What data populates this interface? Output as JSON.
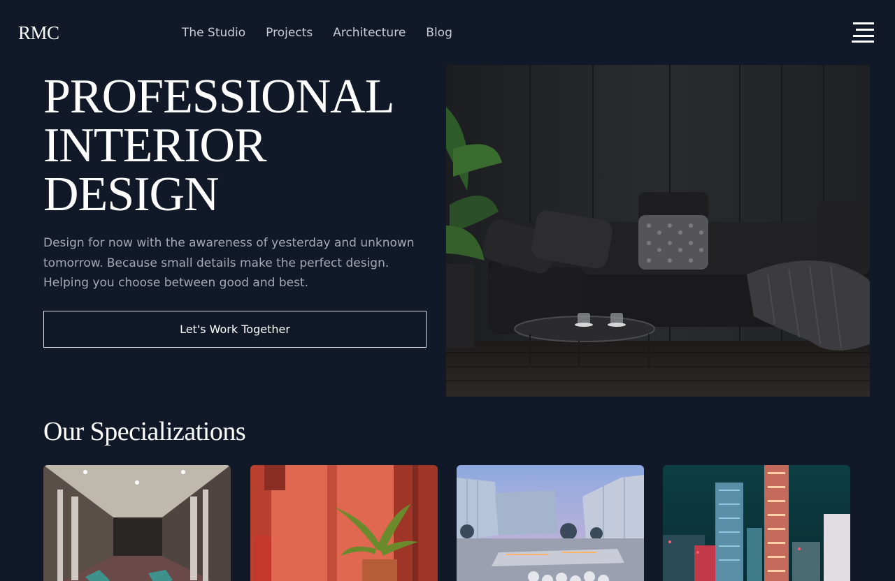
{
  "brand": {
    "logo": "RMC"
  },
  "nav": {
    "items": [
      "The Studio",
      "Projects",
      "Architecture",
      "Blog"
    ]
  },
  "hero": {
    "title_lines": [
      "PROFESSIONAL",
      "INTERIOR",
      "DESIGN"
    ],
    "description": "Design for now with the awareness of yesterday and unknown tomorrow. Because small details make the perfect design. Helping you choose between good and best.",
    "cta_label": "Let's Work Together"
  },
  "specializations": {
    "title": "Our Specializations",
    "cards": [
      {
        "image": "hotel-corridor-photo"
      },
      {
        "image": "orange-room-plant-photo"
      },
      {
        "image": "modern-building-dusk-photo"
      },
      {
        "image": "city-night-skyline-photo"
      }
    ]
  },
  "colors": {
    "background": "#111827",
    "text": "#ffffff",
    "muted_text": "#a3a9b6"
  }
}
